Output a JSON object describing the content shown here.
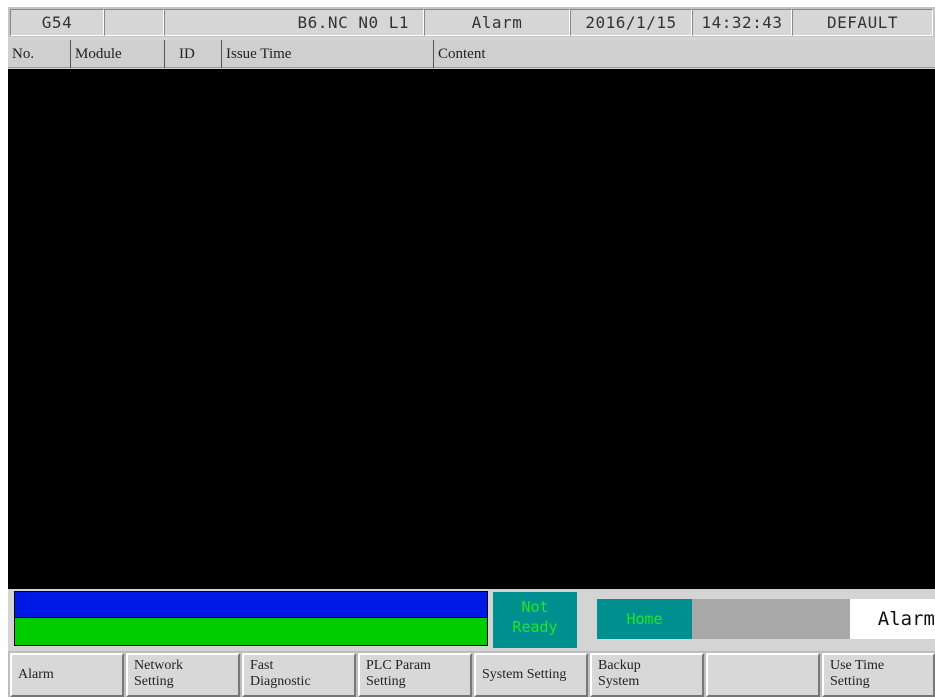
{
  "topbar": {
    "coord": "G54",
    "blank": "",
    "program": "B6.NC N0 L1",
    "mode": "Alarm",
    "date": "2016/1/15",
    "time": "14:32:43",
    "profile": "DEFAULT"
  },
  "table": {
    "columns": [
      "No.",
      "Module",
      "ID",
      "Issue Time",
      "Content"
    ],
    "rows": []
  },
  "status": {
    "state_line1": "Not",
    "state_line2": "Ready",
    "position": "Home",
    "page": "Alarm",
    "colors": {
      "upper_bar": "#0018e6",
      "lower_bar": "#00cc00",
      "indicator_bg": "#008f8f",
      "indicator_text": "#22e622"
    }
  },
  "softkeys": [
    {
      "line1": "Alarm",
      "line2": ""
    },
    {
      "line1": "Network",
      "line2": "Setting"
    },
    {
      "line1": "Fast",
      "line2": "Diagnostic"
    },
    {
      "line1": "PLC Param",
      "line2": "Setting"
    },
    {
      "line1": "System Setting",
      "line2": ""
    },
    {
      "line1": "Backup",
      "line2": "System"
    },
    {
      "line1": "",
      "line2": ""
    },
    {
      "line1": "Use Time",
      "line2": "Setting"
    }
  ]
}
